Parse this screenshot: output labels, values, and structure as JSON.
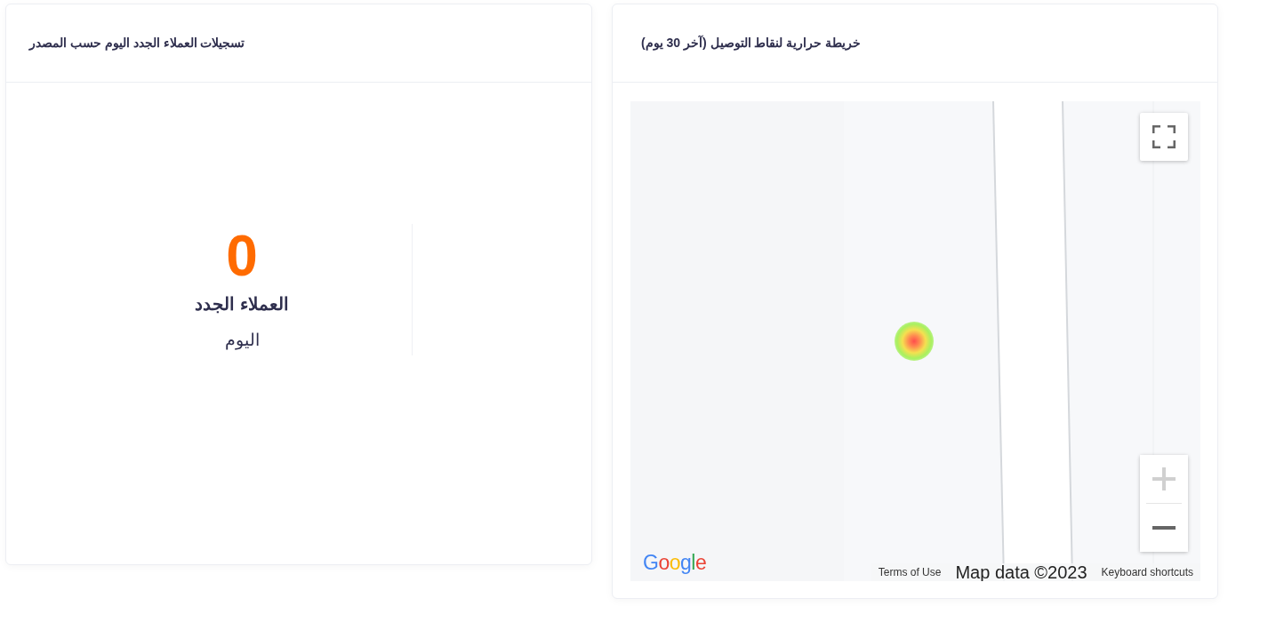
{
  "signups_card": {
    "title": "تسجيلات العملاء الجدد اليوم حسب المصدر",
    "stat": {
      "value": "0",
      "label": "العملاء الجدد",
      "sublabel": "اليوم"
    }
  },
  "heatmap_card": {
    "title": "خريطة حرارية لنقاط التوصيل (آخر 30 يوم)",
    "map": {
      "logo": "Google",
      "zoom_in": {
        "disabled": true
      },
      "zoom_out": {
        "disabled": false
      },
      "terms_link": "Terms of Use",
      "attribution": "Map data ©2023",
      "shortcuts_link": "Keyboard shortcuts"
    }
  }
}
